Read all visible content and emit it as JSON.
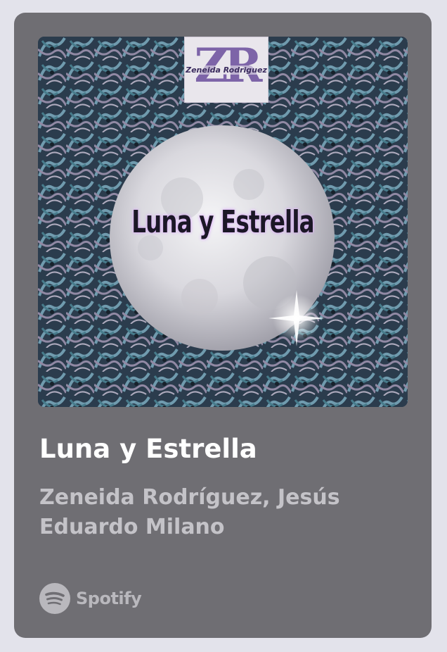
{
  "track": {
    "title": "Luna y Estrella",
    "artists": "Zeneida Rodríguez, Jesús Eduardo Milano"
  },
  "cover": {
    "title": "Luna y Estrella",
    "logo_letters": "ZR",
    "logo_name": "Zeneida Rodriguez"
  },
  "brand": {
    "name": "Spotify",
    "icon": "spotify-icon"
  },
  "colors": {
    "page_background": "#e3e3eb",
    "card_background": "#6f6e73",
    "title_text": "#ffffff",
    "artist_text": "#c4c3c8",
    "brand_text": "#b9b8bd"
  }
}
